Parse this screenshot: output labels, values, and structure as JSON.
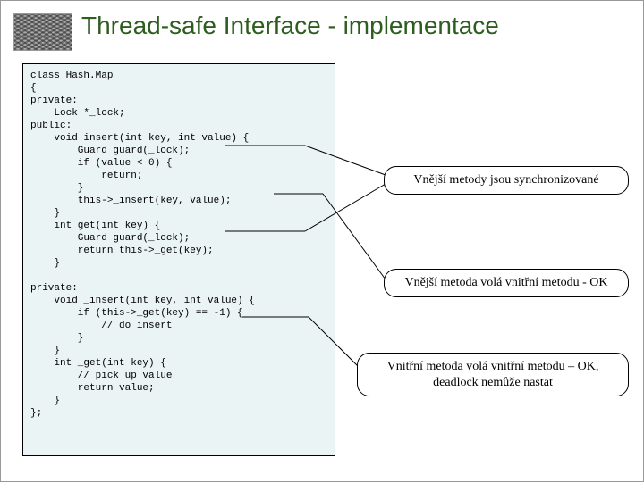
{
  "title": "Thread-safe Interface - implementace",
  "code": "class Hash.Map\n{\nprivate:\n    Lock *_lock;\npublic:\n    void insert(int key, int value) {\n        Guard guard(_lock);\n        if (value < 0) {\n            return;\n        }\n        this->_insert(key, value);\n    }\n    int get(int key) {\n        Guard guard(_lock);\n        return this->_get(key);\n    }\n\nprivate:\n    void _insert(int key, int value) {\n        if (this->_get(key) == -1) {\n            // do insert\n        }\n    }\n    int _get(int key) {\n        // pick up value\n        return value;\n    }\n};",
  "callouts": {
    "c1": "Vnější metody jsou synchronizované",
    "c2": "Vnější metoda volá vnitřní metodu - OK",
    "c3": "Vnitřní metoda volá vnitřní metodu – OK,\ndeadlock nemůže nastat"
  }
}
